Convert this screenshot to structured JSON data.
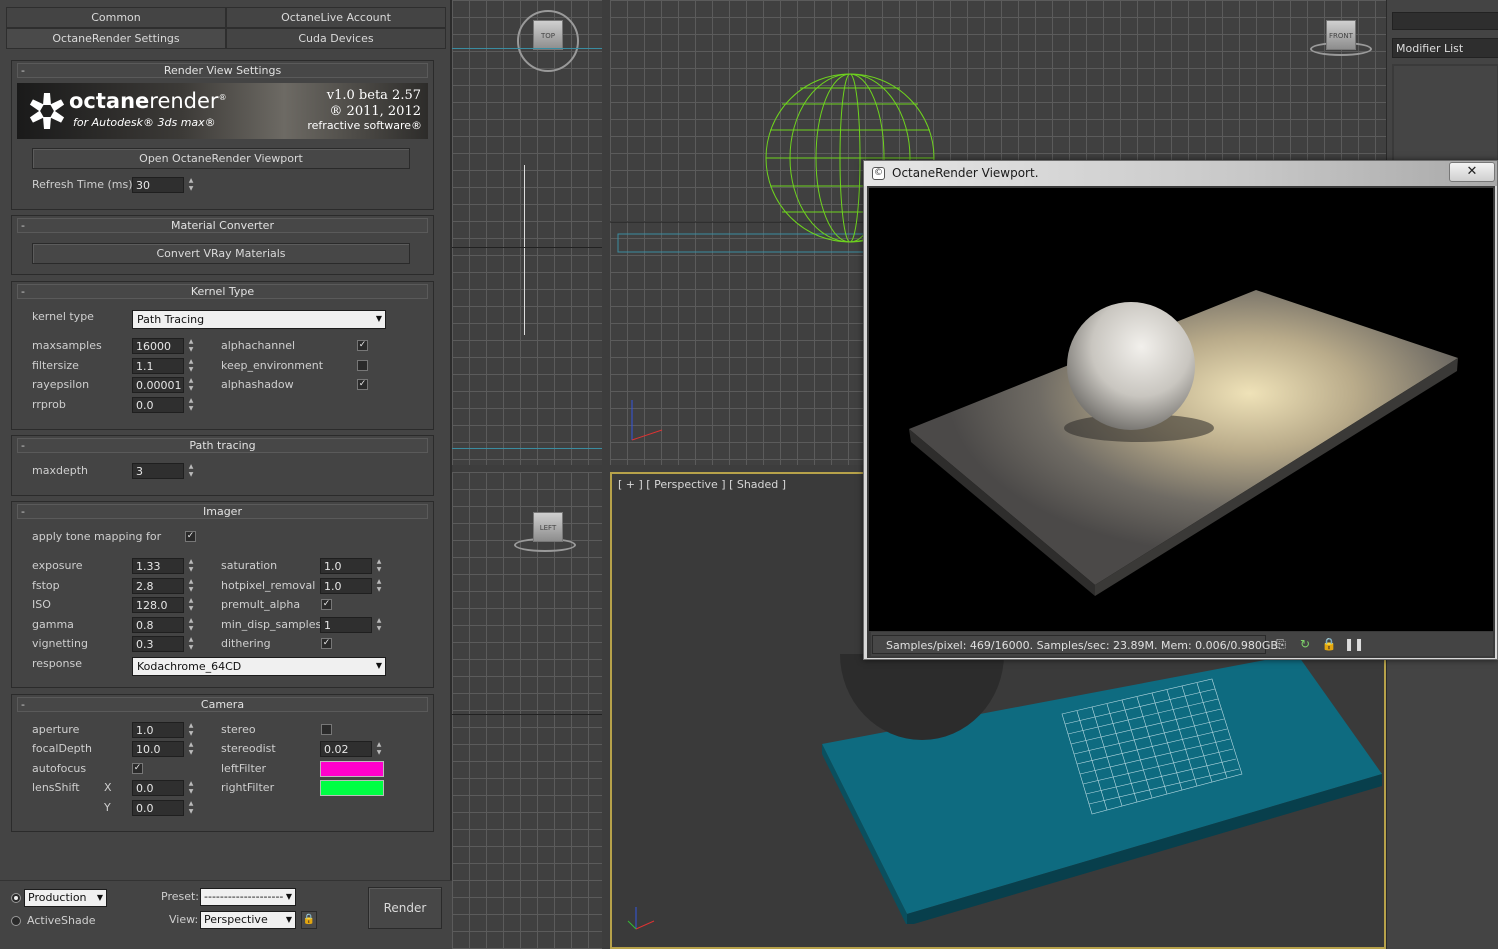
{
  "tabs_row1": [
    "Common",
    "OctaneLive Account"
  ],
  "tabs_row2": [
    "OctaneRender Settings",
    "Cuda Devices"
  ],
  "render_view": {
    "title": "Render View Settings",
    "banner_brand_a": "octane",
    "banner_brand_b": "render",
    "banner_sub": "for Autodesk® 3ds max®",
    "banner_version": "v1.0 beta 2.57",
    "banner_copyright": "® 2011, 2012",
    "banner_company": "refractive software®",
    "open_viewport_button": "Open OctaneRender Viewport",
    "refresh_label": "Refresh Time (ms)",
    "refresh_value": "30"
  },
  "material_converter": {
    "title": "Material Converter",
    "convert_button": "Convert VRay Materials"
  },
  "kernel": {
    "title": "Kernel Type",
    "kernel_type_label": "kernel type",
    "kernel_type_value": "Path Tracing",
    "maxsamples_label": "maxsamples",
    "maxsamples_value": "16000",
    "filtersize_label": "filtersize",
    "filtersize_value": "1.1",
    "rayepsilon_label": "rayepsilon",
    "rayepsilon_value": "0.00001",
    "rrprob_label": "rrprob",
    "rrprob_value": "0.0",
    "alphachannel_label": "alphachannel",
    "alphachannel_checked": true,
    "keep_environment_label": "keep_environment",
    "keep_environment_checked": false,
    "alphashadow_label": "alphashadow",
    "alphashadow_checked": true
  },
  "path_tracing": {
    "title": "Path tracing",
    "maxdepth_label": "maxdepth",
    "maxdepth_value": "3"
  },
  "imager": {
    "title": "Imager",
    "tone_mapping_label": "apply tone mapping for",
    "tone_mapping_checked": true,
    "exposure_label": "exposure",
    "exposure_value": "1.33",
    "fstop_label": "fstop",
    "fstop_value": "2.8",
    "iso_label": "ISO",
    "iso_value": "128.0",
    "gamma_label": "gamma",
    "gamma_value": "0.8",
    "vignetting_label": "vignetting",
    "vignetting_value": "0.3",
    "response_label": "response",
    "response_value": "Kodachrome_64CD",
    "saturation_label": "saturation",
    "saturation_value": "1.0",
    "hotpixel_label": "hotpixel_removal",
    "hotpixel_value": "1.0",
    "premult_label": "premult_alpha",
    "premult_checked": true,
    "min_disp_label": "min_disp_samples",
    "min_disp_value": "1",
    "dithering_label": "dithering",
    "dithering_checked": true
  },
  "camera": {
    "title": "Camera",
    "aperture_label": "aperture",
    "aperture_value": "1.0",
    "focaldepth_label": "focalDepth",
    "focaldepth_value": "10.0",
    "autofocus_label": "autofocus",
    "autofocus_checked": true,
    "lensshift_label": "lensShift",
    "x_label": "X",
    "x_value": "0.0",
    "y_label": "Y",
    "y_value": "0.0",
    "stereo_label": "stereo",
    "stereo_checked": false,
    "stereodist_label": "stereodist",
    "stereodist_value": "0.02",
    "leftfilter_label": "leftFilter",
    "leftfilter_color": "#ff00cc",
    "rightfilter_label": "rightFilter",
    "rightfilter_color": "#00ff44"
  },
  "bottom": {
    "production_label": "Production",
    "activeshade_label": "ActiveShade",
    "preset_label": "Preset:",
    "preset_value": "--------------------",
    "view_label": "View:",
    "view_value": "Perspective",
    "render_button": "Render"
  },
  "viewports": {
    "top_cube": "TOP",
    "front_cube": "FRONT",
    "left_cube": "LEFT",
    "perspective_label": "[ + ] [ Perspective ] [ Shaded ]",
    "plane_color": "#0e6b80"
  },
  "command_panel": {
    "modifier_list": "Modifier List"
  },
  "octane_window": {
    "title": "OctaneRender Viewport.",
    "close_glyph": "✕",
    "status": "Samples/pixel: 469/16000. Samples/sec: 23.89M. Mem: 0.006/0.980GB."
  }
}
